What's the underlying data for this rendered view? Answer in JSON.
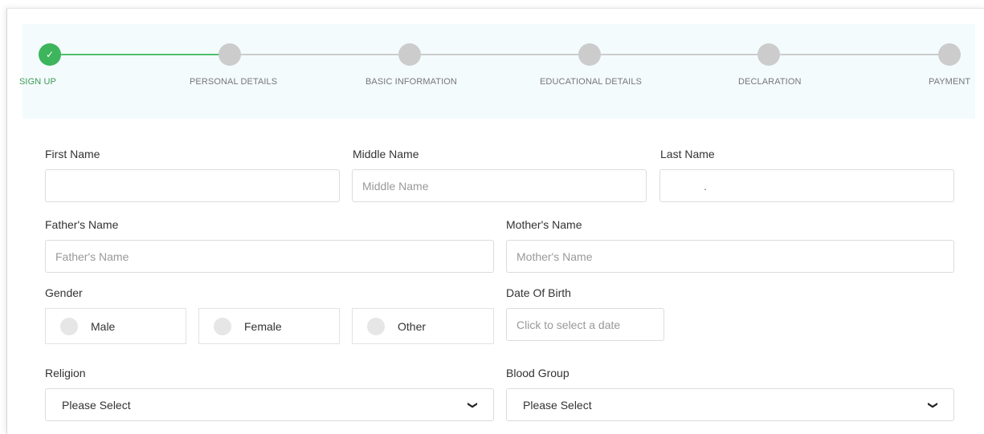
{
  "steps": [
    {
      "label": "SIGN UP",
      "state": "done",
      "icon": "check-icon",
      "icon_glyph": "✓"
    },
    {
      "label": "PERSONAL DETAILS",
      "state": "pending"
    },
    {
      "label": "BASIC INFORMATION",
      "state": "pending"
    },
    {
      "label": "EDUCATIONAL DETAILS",
      "state": "pending"
    },
    {
      "label": "DECLARATION",
      "state": "pending"
    },
    {
      "label": "PAYMENT",
      "state": "pending"
    }
  ],
  "form": {
    "first_name": {
      "label": "First Name",
      "value": "",
      "placeholder": ""
    },
    "middle_name": {
      "label": "Middle Name",
      "value": "",
      "placeholder": "Middle Name"
    },
    "last_name": {
      "label": "Last Name",
      "value": ".",
      "placeholder": ""
    },
    "father_name": {
      "label": "Father's Name",
      "value": "",
      "placeholder": "Father's Name"
    },
    "mother_name": {
      "label": "Mother's Name",
      "value": "",
      "placeholder": "Mother's Name"
    },
    "gender": {
      "label": "Gender",
      "options": [
        "Male",
        "Female",
        "Other"
      ]
    },
    "dob": {
      "label": "Date Of Birth",
      "placeholder": "Click to select a date"
    },
    "religion": {
      "label": "Religion",
      "selected": "Please Select"
    },
    "blood_group": {
      "label": "Blood Group",
      "selected": "Please Select"
    }
  },
  "colors": {
    "accent": "#3db55c",
    "inactive": "#cccccc",
    "stepper_background": "#f4fbfd"
  }
}
